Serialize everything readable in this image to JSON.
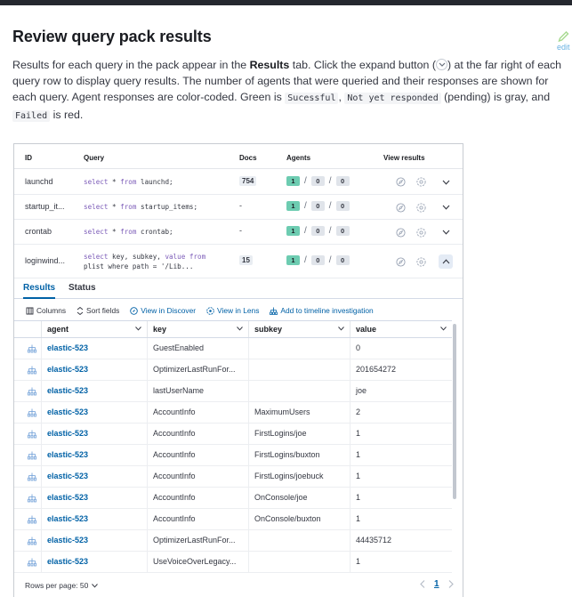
{
  "page": {
    "title": "Review query pack results",
    "edit_label": "edit",
    "intro": {
      "p1": "Results for each query in the pack appear in the ",
      "results_word": "Results",
      "p2": " tab. Click the expand button (",
      "p3": ") at the far right of each query row to display query results. The number of agents that were queried and their responses are shown for each query. Agent responses are color-coded. Green is ",
      "code_success": "Sucessful",
      "p4": ", ",
      "code_pending": "Not yet responded",
      "p5": " (pending) is gray, and ",
      "code_failed": "Failed",
      "p6": " is red."
    }
  },
  "query_table": {
    "headers": {
      "id": "ID",
      "query": "Query",
      "docs": "Docs",
      "agents": "Agents",
      "view": "View results"
    },
    "rows": [
      {
        "id": "launchd",
        "query_kw1": "select",
        "query_mid1": " * ",
        "query_kw2": "from",
        "query_rest": " launchd;",
        "query_line2": "",
        "docs": "754",
        "docs_badge": true,
        "ok": "1",
        "pending": "0",
        "failed": "0",
        "expanded": false
      },
      {
        "id": "startup_it...",
        "query_kw1": "select",
        "query_mid1": " * ",
        "query_kw2": "from",
        "query_rest": " startup_items;",
        "query_line2": "",
        "docs": "-",
        "docs_badge": false,
        "ok": "1",
        "pending": "0",
        "failed": "0",
        "expanded": false
      },
      {
        "id": "crontab",
        "query_kw1": "select",
        "query_mid1": " * ",
        "query_kw2": "from",
        "query_rest": " crontab;",
        "query_line2": "",
        "docs": "-",
        "docs_badge": false,
        "ok": "1",
        "pending": "0",
        "failed": "0",
        "expanded": false
      },
      {
        "id": "loginwind...",
        "query_kw1": "select",
        "query_mid1": " key, subkey, ",
        "query_kw2": "value from",
        "query_rest": "",
        "query_line2": "plist where path = '/Lib...",
        "docs": "15",
        "docs_badge": true,
        "ok": "1",
        "pending": "0",
        "failed": "0",
        "expanded": true
      }
    ]
  },
  "tabs": [
    {
      "label": "Results",
      "active": true
    },
    {
      "label": "Status",
      "active": false
    }
  ],
  "toolbar": {
    "columns": "Columns",
    "sort": "Sort fields",
    "discover": "View in Discover",
    "lens": "View in Lens",
    "timeline": "Add to timeline investigation"
  },
  "grid": {
    "columns": [
      "agent",
      "key",
      "subkey",
      "value"
    ],
    "rows": [
      {
        "agent": "elastic-523",
        "key": "GuestEnabled",
        "subkey": "",
        "value": "0"
      },
      {
        "agent": "elastic-523",
        "key": "OptimizerLastRunFor...",
        "subkey": "",
        "value": "201654272"
      },
      {
        "agent": "elastic-523",
        "key": "lastUserName",
        "subkey": "",
        "value": "joe"
      },
      {
        "agent": "elastic-523",
        "key": "AccountInfo",
        "subkey": "MaximumUsers",
        "value": "2"
      },
      {
        "agent": "elastic-523",
        "key": "AccountInfo",
        "subkey": "FirstLogins/joe",
        "value": "1"
      },
      {
        "agent": "elastic-523",
        "key": "AccountInfo",
        "subkey": "FirstLogins/buxton",
        "value": "1"
      },
      {
        "agent": "elastic-523",
        "key": "AccountInfo",
        "subkey": "FirstLogins/joebuck",
        "value": "1"
      },
      {
        "agent": "elastic-523",
        "key": "AccountInfo",
        "subkey": "OnConsole/joe",
        "value": "1"
      },
      {
        "agent": "elastic-523",
        "key": "AccountInfo",
        "subkey": "OnConsole/buxton",
        "value": "1"
      },
      {
        "agent": "elastic-523",
        "key": "OptimizerLastRunFor...",
        "subkey": "",
        "value": "44435712"
      },
      {
        "agent": "elastic-523",
        "key": "UseVoiceOverLegacy...",
        "subkey": "",
        "value": "1"
      }
    ]
  },
  "pager": {
    "rows_per_page": "Rows per page: 50",
    "page": "1"
  },
  "colors": {
    "success": "#6dccb1",
    "pending": "#e0e4ea",
    "link": "#0061a6"
  }
}
